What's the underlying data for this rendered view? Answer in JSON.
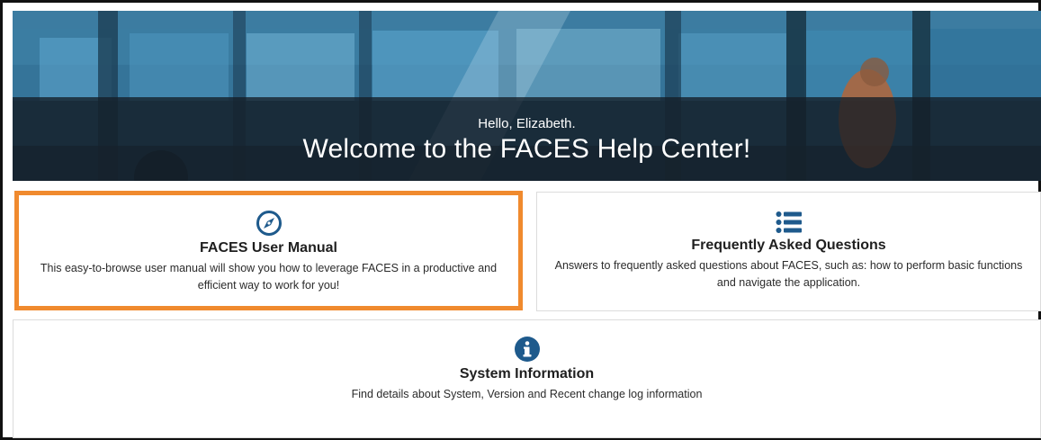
{
  "hero": {
    "greeting": "Hello, Elizabeth.",
    "welcome": "Welcome to the FACES Help Center!"
  },
  "cards": {
    "manual": {
      "icon": "compass-icon",
      "title": "FACES User Manual",
      "description": "This easy-to-browse user manual will show you how to leverage FACES in a productive and efficient way to work for you!"
    },
    "faq": {
      "icon": "list-icon",
      "title": "Frequently Asked Questions",
      "description": "Answers to frequently asked questions about FACES, such as: how to perform basic functions and navigate the application."
    },
    "sysinfo": {
      "icon": "info-icon",
      "title": "System Information",
      "description": "Find details about System, Version and Recent change log information"
    }
  },
  "colors": {
    "accent": "#1e5a8c",
    "highlight": "#f08a2e"
  }
}
